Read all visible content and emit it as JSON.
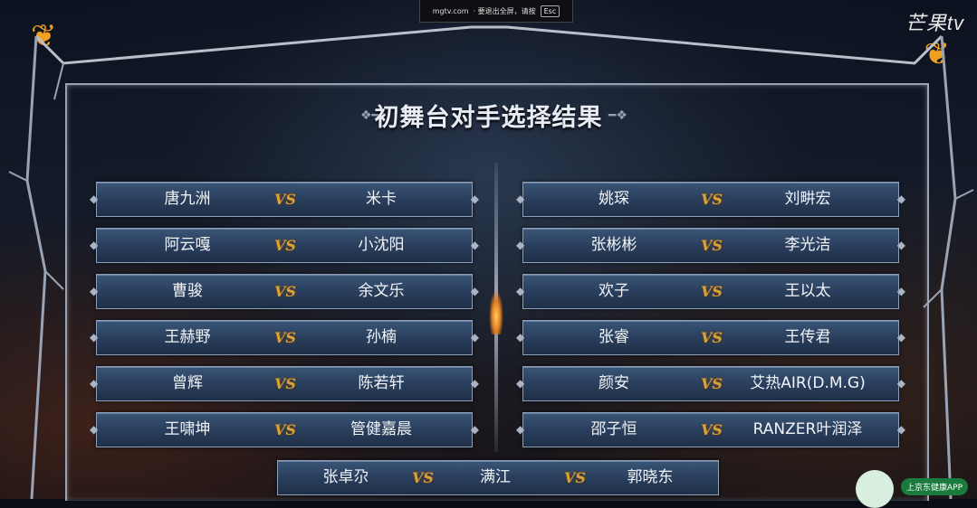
{
  "topbar": {
    "site": "mgtv.com",
    "hint": "· 要退出全屏，请按",
    "esc_key": "Esc"
  },
  "logo": "芒果tv",
  "title": "初舞台对手选择结果",
  "left_matches": [
    {
      "a": "唐九洲",
      "vs": "VS",
      "b": "米卡"
    },
    {
      "a": "阿云嘎",
      "vs": "VS",
      "b": "小沈阳"
    },
    {
      "a": "曹骏",
      "vs": "VS",
      "b": "余文乐"
    },
    {
      "a": "王赫野",
      "vs": "VS",
      "b": "孙楠"
    },
    {
      "a": "曾辉",
      "vs": "VS",
      "b": "陈若轩"
    },
    {
      "a": "王啸坤",
      "vs": "VS",
      "b": "管健嘉晨"
    }
  ],
  "right_matches": [
    {
      "a": "姚琛",
      "vs": "VS",
      "b": "刘畊宏"
    },
    {
      "a": "张彬彬",
      "vs": "VS",
      "b": "李光洁"
    },
    {
      "a": "欢子",
      "vs": "VS",
      "b": "王以太"
    },
    {
      "a": "张睿",
      "vs": "VS",
      "b": "王传君"
    },
    {
      "a": "颜安",
      "vs": "VS",
      "b": "艾热AIR(D.M.G)"
    },
    {
      "a": "邵子恒",
      "vs": "VS",
      "b": "RANZER叶润泽"
    }
  ],
  "bottom_match": {
    "a": "张卓尕",
    "vs1": "VS",
    "b": "满江",
    "vs2": "VS",
    "c": "郭晓东"
  },
  "app_badge": "上京东健康APP",
  "colors": {
    "vs_gold": "#d8a13a",
    "row_blue": "#2a3f5d",
    "flame": "#f0a020"
  }
}
